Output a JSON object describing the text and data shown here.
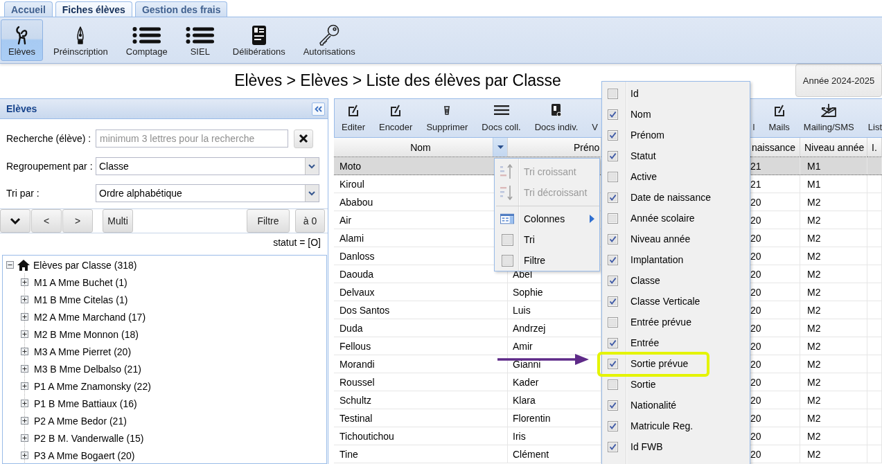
{
  "tabs": [
    {
      "label": "Accueil",
      "selected": false
    },
    {
      "label": "Fiches élèves",
      "selected": true
    },
    {
      "label": "Gestion des frais",
      "selected": false
    }
  ],
  "ribbon": [
    {
      "label": "Elèves",
      "selected": true
    },
    {
      "label": "Préinscription",
      "selected": false
    },
    {
      "label": "Comptage",
      "selected": false
    },
    {
      "label": "SIEL",
      "selected": false
    },
    {
      "label": "Délibérations",
      "selected": false
    },
    {
      "label": "Autorisations",
      "selected": false
    }
  ],
  "page_title": "Elèves > Elèves > Liste des élèves par Classe",
  "year_button": "Année 2024-2025",
  "sidebar": {
    "title": "Elèves",
    "search": {
      "label": "Recherche (élève) :",
      "placeholder": "minimum 3 lettres pour la recherche"
    },
    "grouping": {
      "label": "Regroupement par :",
      "value": "Classe"
    },
    "sort": {
      "label": "Tri par :",
      "value": "Ordre alphabétique"
    },
    "nav_buttons": [
      "<",
      ">"
    ],
    "multi_button": "Multi",
    "filter_button": "Filtre",
    "reset_button": "à 0",
    "status_filter": "statut = [O]",
    "tree": {
      "label": "Elèves par Classe (318)",
      "expanded": true,
      "children": [
        {
          "label": "M1 A Mme Buchet (1)",
          "expanded": false
        },
        {
          "label": "M1 B Mme Citelas (1)",
          "expanded": false
        },
        {
          "label": "M2 A Mme Marchand (17)",
          "expanded": false
        },
        {
          "label": "M2 B Mme Monnon (18)",
          "expanded": false
        },
        {
          "label": "M3 A Mme Pierret (20)",
          "expanded": false
        },
        {
          "label": "M3 B Mme Delbalso (21)",
          "expanded": false
        },
        {
          "label": "P1 A Mme Znamonsky (22)",
          "expanded": false
        },
        {
          "label": "P1 B Mme Battiaux (16)",
          "expanded": false
        },
        {
          "label": "P2 A Mme Bedor (21)",
          "expanded": false
        },
        {
          "label": "P2 B M. Vanderwalle (15)",
          "expanded": false
        },
        {
          "label": "P3 A Mme Bogaert (20)",
          "expanded": false
        }
      ]
    }
  },
  "toolbar": [
    "Editer",
    "Encoder",
    "Supprimer",
    "Docs coll.",
    "Docs indiv.",
    "V",
    "l",
    "Mails",
    "Mailing/SMS",
    "List"
  ],
  "table": {
    "columns": [
      "Nom",
      "Préno",
      "naissance",
      "Niveau année",
      "I."
    ],
    "rows": [
      {
        "nom": "Moto",
        "naissance": "21",
        "niveau": "M1",
        "selected": true
      },
      {
        "nom": "Kiroul",
        "naissance": "21",
        "niveau": "M1",
        "selected": false
      },
      {
        "nom": "Ababou",
        "naissance": "20",
        "niveau": "M2",
        "selected": false
      },
      {
        "nom": "Air",
        "naissance": "20",
        "niveau": "M2",
        "selected": false
      },
      {
        "nom": "Alami",
        "naissance": "20",
        "niveau": "M2",
        "selected": false
      },
      {
        "nom": "Danloss",
        "naissance": "20",
        "niveau": "M2",
        "selected": false
      },
      {
        "nom": "Daouda",
        "prenom": "Abel",
        "naissance": "20",
        "niveau": "M2",
        "selected": false
      },
      {
        "nom": "Delvaux",
        "prenom": "Sophie",
        "naissance": "20",
        "niveau": "M2",
        "selected": false
      },
      {
        "nom": "Dos Santos",
        "prenom": "Luis",
        "naissance": "20",
        "niveau": "M2",
        "selected": false
      },
      {
        "nom": "Duda",
        "prenom": "Andrzej",
        "naissance": "20",
        "niveau": "M2",
        "selected": false
      },
      {
        "nom": "Fellous",
        "prenom": "Amir",
        "naissance": "20",
        "niveau": "M2",
        "selected": false
      },
      {
        "nom": "Morandi",
        "prenom": "Gianni",
        "naissance": "20",
        "niveau": "M2",
        "selected": false
      },
      {
        "nom": "Roussel",
        "prenom": "Kader",
        "naissance": "20",
        "niveau": "M2",
        "selected": false
      },
      {
        "nom": "Schultz",
        "prenom": "Klara",
        "naissance": "20",
        "niveau": "M2",
        "selected": false
      },
      {
        "nom": "Testinal",
        "prenom": "Florentin",
        "naissance": "20",
        "niveau": "M2",
        "selected": false
      },
      {
        "nom": "Tichoutichou",
        "prenom": "Iris",
        "naissance": "20",
        "niveau": "M2",
        "selected": false
      },
      {
        "nom": "Tine",
        "prenom": "Clément",
        "naissance": "20",
        "niveau": "M2",
        "selected": false
      }
    ]
  },
  "header_menu": {
    "items": [
      {
        "kind": "sort_asc",
        "label": "Tri croissant",
        "disabled": true
      },
      {
        "kind": "sort_desc",
        "label": "Tri décroissant",
        "disabled": true
      },
      {
        "kind": "submenu",
        "label": "Colonnes",
        "disabled": false
      },
      {
        "kind": "check",
        "label": "Tri",
        "checked": false,
        "disabled": false
      },
      {
        "kind": "check",
        "label": "Filtre",
        "checked": false,
        "disabled": false
      }
    ]
  },
  "columns_menu": {
    "items": [
      {
        "label": "Id",
        "checked": false,
        "highlighted": false
      },
      {
        "label": "Nom",
        "checked": true,
        "highlighted": false
      },
      {
        "label": "Prénom",
        "checked": true,
        "highlighted": false
      },
      {
        "label": "Statut",
        "checked": true,
        "highlighted": false
      },
      {
        "label": "Active",
        "checked": false,
        "highlighted": false
      },
      {
        "label": "Date de naissance",
        "checked": true,
        "highlighted": false
      },
      {
        "label": "Année scolaire",
        "checked": false,
        "highlighted": false
      },
      {
        "label": "Niveau année",
        "checked": true,
        "highlighted": false
      },
      {
        "label": "Implantation",
        "checked": true,
        "highlighted": false
      },
      {
        "label": "Classe",
        "checked": true,
        "highlighted": false
      },
      {
        "label": "Classe Verticale",
        "checked": true,
        "highlighted": false
      },
      {
        "label": "Entrée prévue",
        "checked": false,
        "highlighted": false
      },
      {
        "label": "Entrée",
        "checked": true,
        "highlighted": false
      },
      {
        "label": "Sortie prévue",
        "checked": true,
        "highlighted": true
      },
      {
        "label": "Sortie",
        "checked": false,
        "highlighted": false
      },
      {
        "label": "Nationalité",
        "checked": true,
        "highlighted": false
      },
      {
        "label": "Matricule Reg.",
        "checked": true,
        "highlighted": false
      },
      {
        "label": "Id FWB",
        "checked": true,
        "highlighted": false
      }
    ]
  }
}
